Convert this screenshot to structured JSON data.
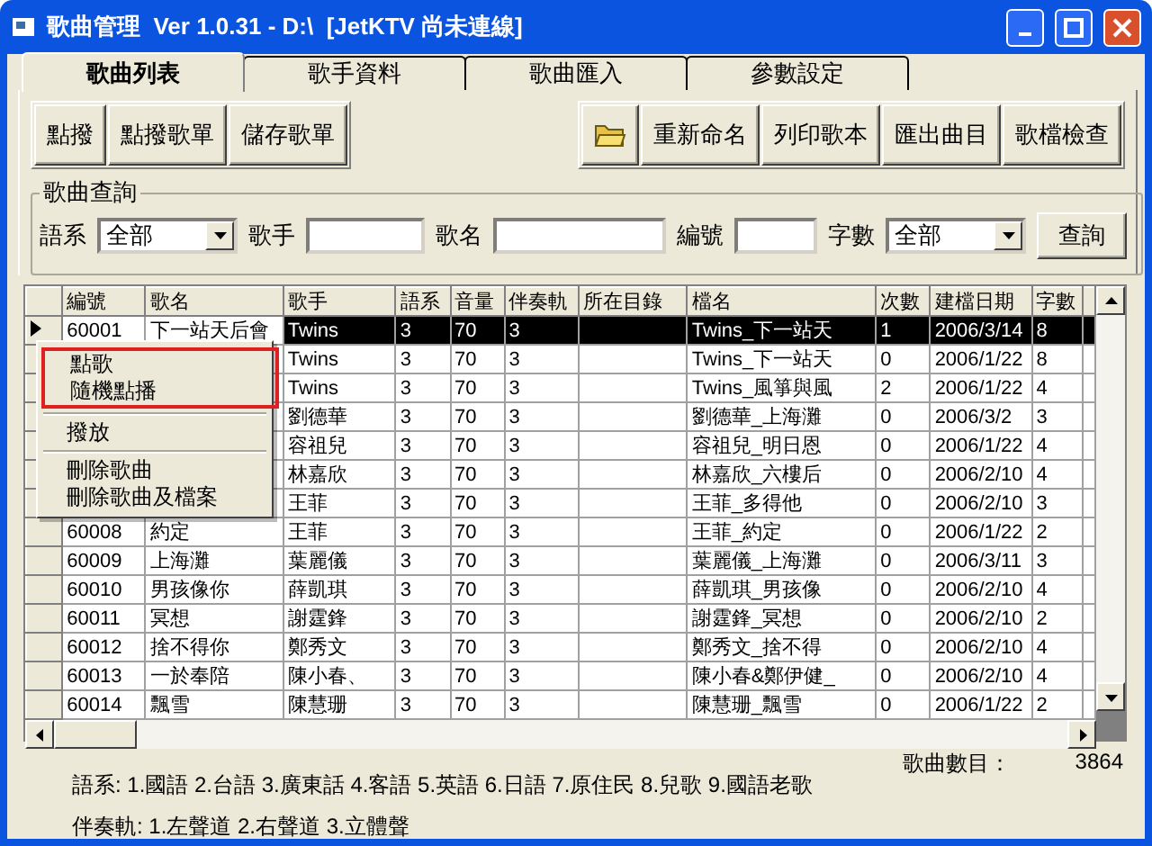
{
  "window": {
    "title": "歌曲管理  Ver 1.0.31 - D:\\  [JetKTV 尚未連線]"
  },
  "tabs": [
    {
      "label": "歌曲列表",
      "selected": true
    },
    {
      "label": "歌手資料",
      "selected": false
    },
    {
      "label": "歌曲匯入",
      "selected": false
    },
    {
      "label": "參數設定",
      "selected": false
    }
  ],
  "toolbar": {
    "left_buttons": [
      "點撥",
      "點撥歌單",
      "儲存歌單"
    ],
    "right_buttons": [
      {
        "kind": "icon"
      },
      {
        "kind": "text",
        "label": "重新命名"
      },
      {
        "kind": "text",
        "label": "列印歌本"
      },
      {
        "kind": "text",
        "label": "匯出曲目"
      },
      {
        "kind": "text",
        "label": "歌檔檢查"
      }
    ]
  },
  "query": {
    "title": "歌曲查詢",
    "fields": [
      {
        "label": "語系",
        "kind": "combo",
        "value": "全部"
      },
      {
        "label": "歌手",
        "kind": "text"
      },
      {
        "label": "歌名",
        "kind": "text"
      },
      {
        "label": "編號",
        "kind": "text"
      },
      {
        "label": "字數",
        "kind": "combo",
        "value": "全部"
      }
    ],
    "button": "查詢"
  },
  "table": {
    "columns": [
      "編號",
      "歌名",
      "歌手",
      "語系",
      "音量",
      "伴奏軌",
      "所在目錄",
      "檔名",
      "次數",
      "建檔日期",
      "字數"
    ],
    "rows": [
      {
        "selected": true,
        "cells": [
          "60001",
          "下一站天后會",
          "Twins",
          "3",
          "70",
          "3",
          "",
          "Twins_下一站天",
          "1",
          "2006/3/14",
          "8"
        ]
      },
      {
        "selected": false,
        "cells": [
          null,
          null,
          "Twins",
          "3",
          "70",
          "3",
          "",
          "Twins_下一站天",
          "0",
          "2006/1/22",
          "8"
        ]
      },
      {
        "selected": false,
        "cells": [
          null,
          null,
          "Twins",
          "3",
          "70",
          "3",
          "",
          "Twins_風箏與風",
          "2",
          "2006/1/22",
          "4"
        ]
      },
      {
        "selected": false,
        "cells": [
          null,
          null,
          "劉德華",
          "3",
          "70",
          "3",
          "",
          "劉德華_上海灘",
          "0",
          "2006/3/2",
          "3"
        ]
      },
      {
        "selected": false,
        "cells": [
          null,
          null,
          "容祖兒",
          "3",
          "70",
          "3",
          "",
          "容祖兒_明日恩",
          "0",
          "2006/1/22",
          "4"
        ]
      },
      {
        "selected": false,
        "cells": [
          null,
          null,
          "林嘉欣",
          "3",
          "70",
          "3",
          "",
          "林嘉欣_六樓后",
          "0",
          "2006/2/10",
          "4"
        ]
      },
      {
        "selected": false,
        "cells": [
          null,
          null,
          "王菲",
          "3",
          "70",
          "3",
          "",
          "王菲_多得他",
          "0",
          "2006/2/10",
          "3"
        ]
      },
      {
        "selected": false,
        "cells": [
          "60008",
          "約定",
          "王菲",
          "3",
          "70",
          "3",
          "",
          "王菲_約定",
          "0",
          "2006/1/22",
          "2"
        ]
      },
      {
        "selected": false,
        "cells": [
          "60009",
          "上海灘",
          "葉麗儀",
          "3",
          "70",
          "3",
          "",
          "葉麗儀_上海灘",
          "0",
          "2006/3/11",
          "3"
        ]
      },
      {
        "selected": false,
        "cells": [
          "60010",
          "男孩像你",
          "薛凱琪",
          "3",
          "70",
          "3",
          "",
          "薛凱琪_男孩像",
          "0",
          "2006/2/10",
          "4"
        ]
      },
      {
        "selected": false,
        "cells": [
          "60011",
          "冥想",
          "謝霆鋒",
          "3",
          "70",
          "3",
          "",
          "謝霆鋒_冥想",
          "0",
          "2006/2/10",
          "2"
        ]
      },
      {
        "selected": false,
        "cells": [
          "60012",
          "捨不得你",
          "鄭秀文",
          "3",
          "70",
          "3",
          "",
          "鄭秀文_捨不得",
          "0",
          "2006/2/10",
          "4"
        ]
      },
      {
        "selected": false,
        "cells": [
          "60013",
          "一於奉陪",
          "陳小春、",
          "3",
          "70",
          "3",
          "",
          "陳小春&鄭伊健_",
          "0",
          "2006/2/10",
          "4"
        ]
      },
      {
        "selected": false,
        "cells": [
          "60014",
          "飄雪",
          "陳慧珊",
          "3",
          "70",
          "3",
          "",
          "陳慧珊_飄雪",
          "0",
          "2006/1/22",
          "2"
        ]
      }
    ]
  },
  "context_menu": {
    "groups": [
      {
        "marked": true,
        "items": [
          "點歌",
          "隨機點播"
        ]
      },
      {
        "marked": false,
        "items": [
          "撥放"
        ]
      },
      {
        "marked": false,
        "items": [
          "刪除歌曲",
          "刪除歌曲及檔案"
        ]
      }
    ]
  },
  "legend": [
    "語系: 1.國語 2.台語 3.廣東話 4.客語 5.英語 6.日語 7.原住民 8.兒歌 9.國語老歌",
    "伴奏軌: 1.左聲道 2.右聲道 3.立體聲"
  ],
  "song_count": {
    "label": "歌曲數目：",
    "value": "3864"
  }
}
